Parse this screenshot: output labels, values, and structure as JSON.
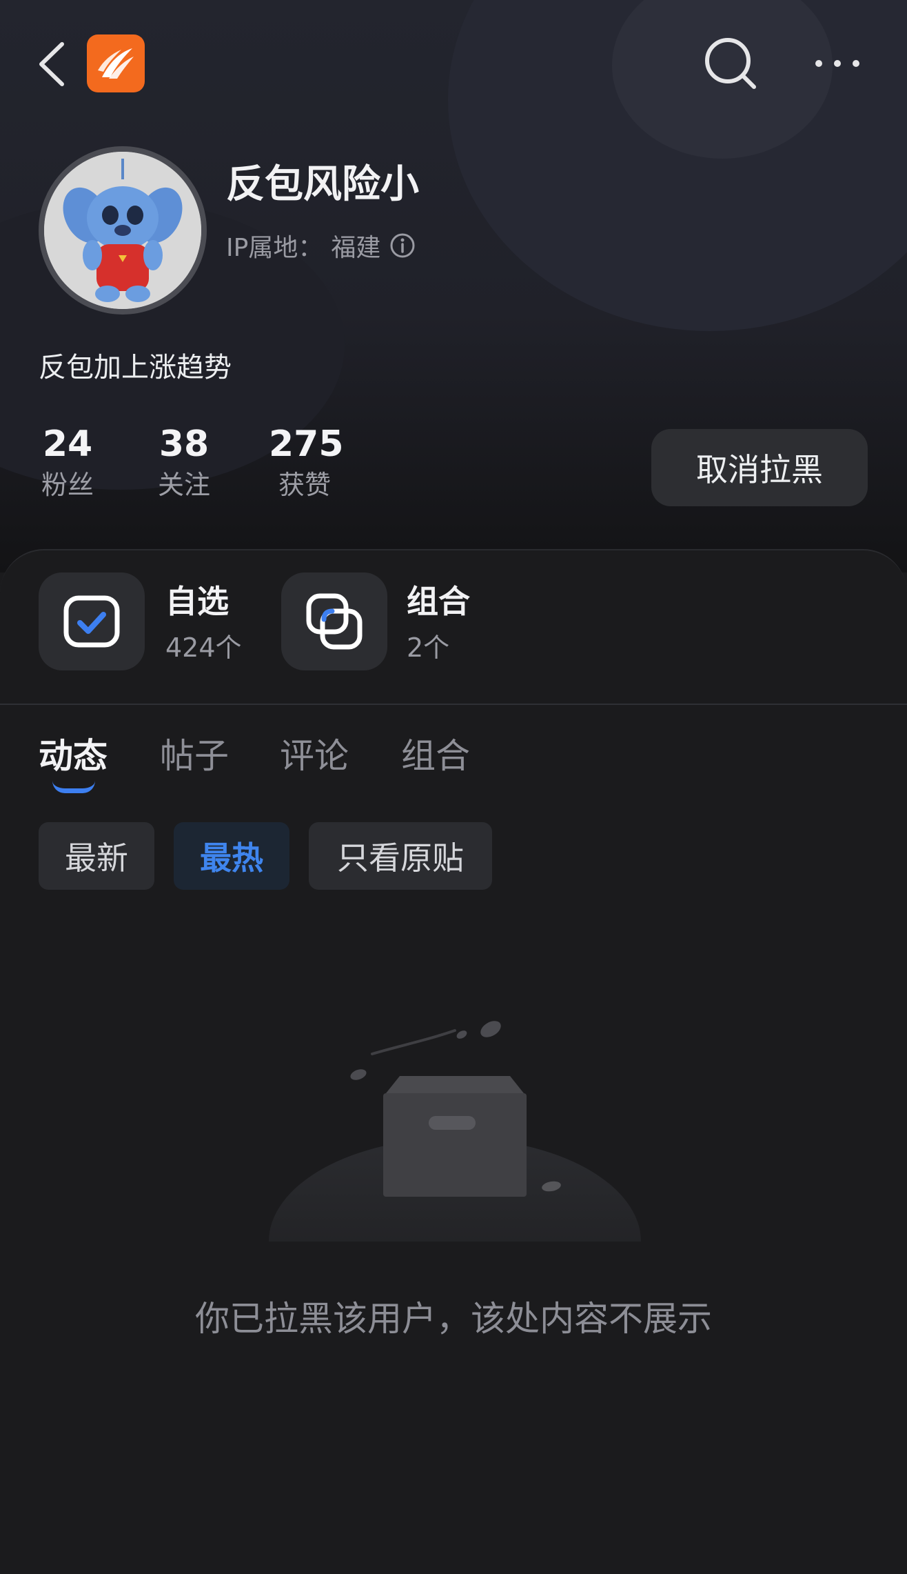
{
  "header": {
    "back_icon": "chevron-left-icon",
    "app_logo": "app-logo-icon",
    "search_icon": "search-icon",
    "more_icon": "more-horizontal-icon"
  },
  "profile": {
    "username": "反包风险小",
    "ip_label": "IP属地：",
    "ip_value": "福建",
    "bio": "反包加上涨趋势",
    "stats": [
      {
        "value": "24",
        "label": "粉丝"
      },
      {
        "value": "38",
        "label": "关注"
      },
      {
        "value": "275",
        "label": "获赞"
      }
    ],
    "unblock_label": "取消拉黑"
  },
  "collections": {
    "watchlist": {
      "title": "自选",
      "count": "424个"
    },
    "portfolio": {
      "title": "组合",
      "count": "2个"
    }
  },
  "tabs": [
    {
      "label": "动态",
      "active": true
    },
    {
      "label": "帖子",
      "active": false
    },
    {
      "label": "评论",
      "active": false
    },
    {
      "label": "组合",
      "active": false
    }
  ],
  "filters": [
    {
      "label": "最新",
      "selected": false
    },
    {
      "label": "最热",
      "selected": true
    },
    {
      "label": "只看原贴",
      "selected": false
    }
  ],
  "empty_state": {
    "message": "你已拉黑该用户，该处内容不展示"
  },
  "colors": {
    "background": "#1b1b1d",
    "accent": "#3d7ff0",
    "logo": "#f36a1e"
  }
}
